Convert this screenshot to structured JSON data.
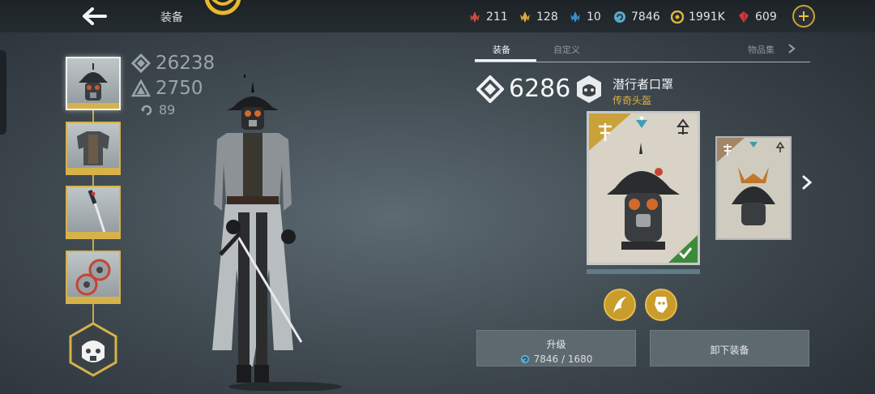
{
  "header": {
    "title": "装备",
    "resources": [
      {
        "name": "red-shard",
        "value": "211",
        "color": "#d44a3c"
      },
      {
        "name": "gold-shard",
        "value": "128",
        "color": "#e0a73a"
      },
      {
        "name": "blue-shard",
        "value": "10",
        "color": "#3a8fd0"
      },
      {
        "name": "rune-coin",
        "value": "7846",
        "color": "#5aa9c8"
      },
      {
        "name": "coin",
        "value": "1991K",
        "color": "#e2b33e"
      },
      {
        "name": "ruby",
        "value": "609",
        "color": "#d23a3a"
      }
    ]
  },
  "stats": {
    "power": "26238",
    "armor": "2750",
    "level": "89"
  },
  "tabs": [
    "装备",
    "自定义",
    "物品集"
  ],
  "item": {
    "power": "6286",
    "name": "潜行者口罩",
    "type": "传奇头盔"
  },
  "buttons": {
    "upgrade_label": "升级",
    "upgrade_cost": "7846 / 1680",
    "unequip_label": "卸下装备"
  },
  "colors": {
    "gold": "#d6b24a",
    "legendary_text": "#e2b33e",
    "button_bg": "#5e686f"
  }
}
